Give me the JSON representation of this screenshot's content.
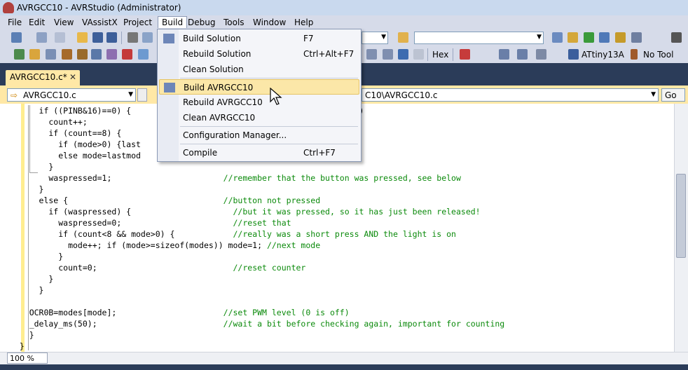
{
  "window": {
    "title": "AVRGCC10 - AVRStudio (Administrator)"
  },
  "menubar": {
    "items": [
      "File",
      "Edit",
      "View",
      "VAssistX",
      "Project",
      "Build",
      "Debug",
      "Tools",
      "Window",
      "Help"
    ],
    "open_menu": "Build"
  },
  "build_menu": {
    "items": [
      {
        "label": "Build Solution",
        "shortcut": "F7"
      },
      {
        "label": "Rebuild Solution",
        "shortcut": "Ctrl+Alt+F7"
      },
      {
        "label": "Clean Solution",
        "shortcut": ""
      },
      {
        "label": "Build AVRGCC10",
        "shortcut": ""
      },
      {
        "label": "Rebuild AVRGCC10",
        "shortcut": ""
      },
      {
        "label": "Clean AVRGCC10",
        "shortcut": ""
      },
      {
        "label": "Configuration Manager...",
        "shortcut": ""
      },
      {
        "label": "Compile",
        "shortcut": "Ctrl+F7"
      }
    ],
    "highlighted": "Build AVRGCC10"
  },
  "toolbar2": {
    "hex_label": "Hex",
    "device_label": "ATtiny13A",
    "tool_label": "No Tool"
  },
  "document_tab": {
    "label": "AVRGCC10.c*",
    "close": "✕"
  },
  "navbar": {
    "file_combo": "AVRGCC10.c",
    "path_combo_visible": "C10\\AVRGCC10.c",
    "go_label": "Go"
  },
  "zoom": {
    "value": "100 %"
  },
  "code_lines": [
    "      if ((PINB&16)==0) {                          ssed (PB4 pulled down)",
    "        count++;                                   ress",
    "        if (count==8) {",
    "          if (mode>0) {last                        t remember the mode",
    "          else mode=lastmod                        h previous mode.",
    "        }",
    "        waspressed=1;                       //remember that the button was pressed, see below",
    "      }",
    "      else {                                //button not pressed",
    "        if (waspressed) {                     //but it was pressed, so it has just been released!",
    "          waspressed=0;                       //reset that",
    "          if (count<8 && mode>0) {            //really was a short press AND the light is on",
    "            mode++; if (mode>=sizeof(modes)) mode=1; //next mode",
    "          }",
    "          count=0;                            //reset counter",
    "        }",
    "      }",
    "",
    "    OCR0B=modes[mode];                      //set PWM level (0 is off)",
    "    _delay_ms(50);                          //wait a bit before checking again, important for counting",
    "    }",
    "  }"
  ],
  "colors": {
    "title_bg": "#c9d9ee",
    "menu_bg": "#d6dbe9",
    "tab_strip": "#2b3c59",
    "doc_tab": "#ffe8a6",
    "comment": "#0b8a0b",
    "highlight": "#fbe7a8"
  },
  "icons": [
    "app-icon",
    "new-project-icon",
    "open-icon",
    "save-icon",
    "save-all-icon",
    "cut-icon",
    "copy-icon",
    "find-icon",
    "solution-explorer-icon",
    "build-icon",
    "close-tab-icon",
    "nav-arrow-icon"
  ]
}
